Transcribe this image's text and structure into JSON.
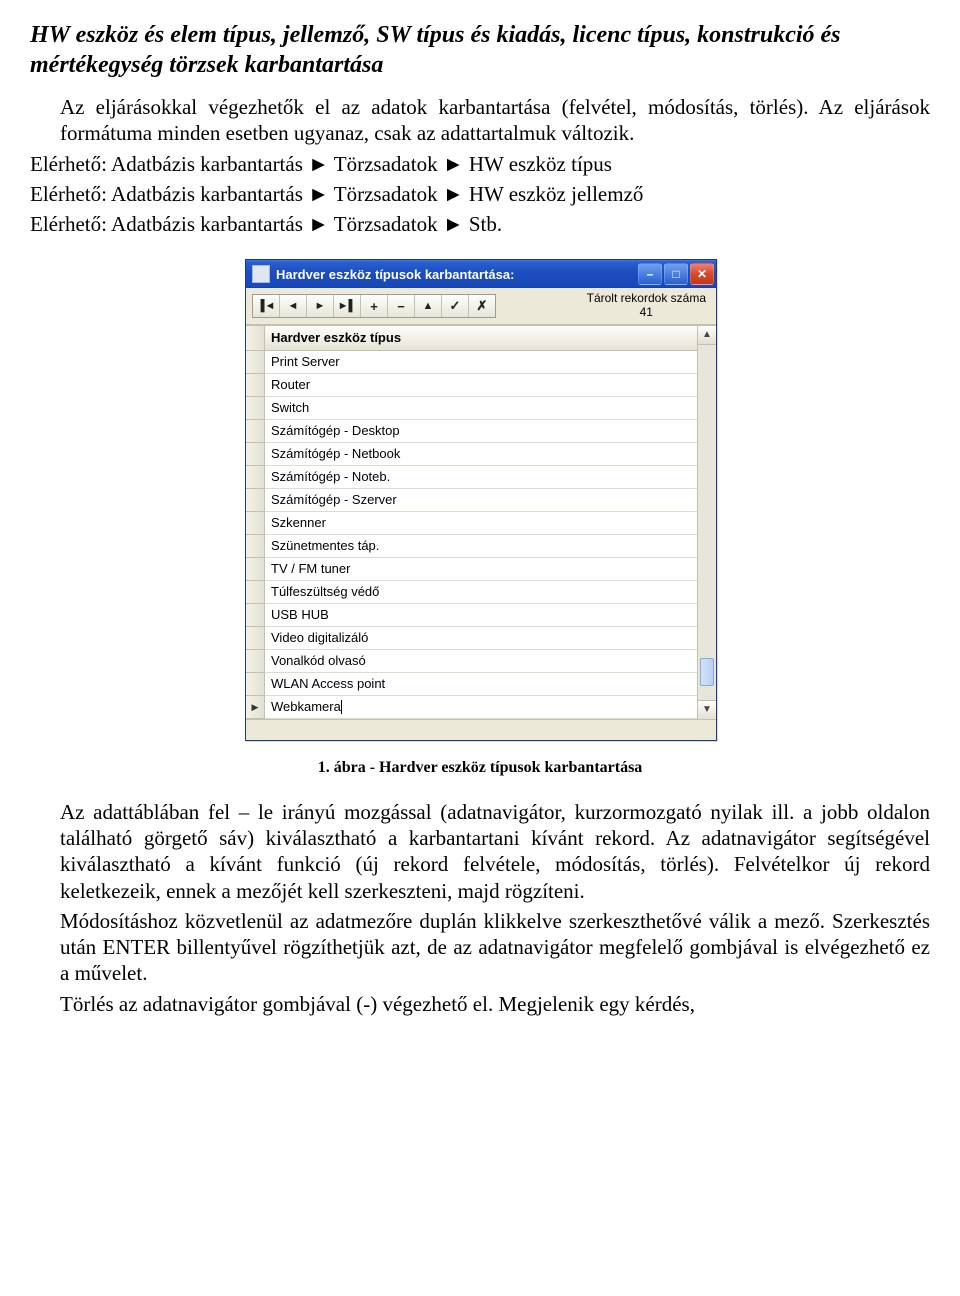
{
  "heading": "HW eszköz és elem típus, jellemző, SW típus és kiadás, licenc típus, konstrukció és mértékegység törzsek karbantartása",
  "intro1": "Az eljárásokkal végezhetők el az adatok karbantartása (felvétel, módosítás, törlés). Az eljárások formátuma minden esetben ugyanaz, csak az adattartalmuk változik.",
  "paths": {
    "p1": "Elérhető: Adatbázis karbantartás ► Törzsadatok ► HW eszköz típus",
    "p2": "Elérhető: Adatbázis karbantartás ► Törzsadatok ► HW eszköz jellemző",
    "p3": "Elérhető: Adatbázis karbantartás ► Törzsadatok ► Stb."
  },
  "window": {
    "title": "Hardver eszköz típusok karbantartása:",
    "record_label": "Tárolt rekordok száma",
    "record_count": "41",
    "nav": {
      "first": "▐◄",
      "prev": "◄",
      "next": "►",
      "last": "►▌",
      "add": "+",
      "delete": "−",
      "edit": "▲",
      "post": "✓",
      "cancel": "✗"
    },
    "column_header": "Hardver eszköz típus",
    "rows": [
      "Print Server",
      "Router",
      "Switch",
      "Számítógép - Desktop",
      "Számítógép - Netbook",
      "Számítógép - Noteb.",
      "Számítógép - Szerver",
      "Szkenner",
      "Szünetmentes táp.",
      "TV / FM tuner",
      "Túlfeszültség védő",
      "USB HUB",
      "Video digitalizáló",
      "Vonalkód olvasó",
      "WLAN Access point",
      "Webkamera"
    ],
    "active_row_index": 15
  },
  "caption": "1. ábra - Hardver eszköz típusok karbantartása",
  "body1": "Az adattáblában fel – le irányú mozgással (adatnavigátor, kurzormozgató nyilak ill. a jobb oldalon található görgető sáv) kiválasztható a karbantartani kívánt rekord. Az adatnavigátor segítségével kiválasztható a kívánt funkció (új rekord felvétele, módosítás, törlés). Felvételkor új rekord keletkezeik, ennek a mezőjét kell szerkeszteni, majd rögzíteni.",
  "body2": "Módosításhoz közvetlenül az adatmezőre duplán klikkelve szerkeszthetővé válik a mező. Szerkesztés után ENTER billentyűvel rögzíthetjük azt, de az adatnavigátor megfelelő gombjával is elvégezhető ez a művelet.",
  "body3": "Törlés az adatnavigátor gombjával (-) végezhető el. Megjelenik egy kérdés,"
}
